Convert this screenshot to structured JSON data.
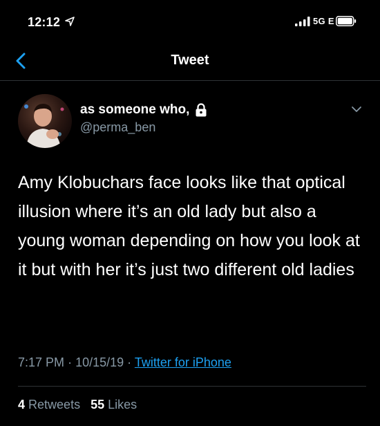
{
  "status_bar": {
    "time": "12:12",
    "network": "5G E",
    "location_icon": "location-arrow-icon",
    "signal_icon": "signal-bars-icon",
    "battery_icon": "battery-icon"
  },
  "nav": {
    "title": "Tweet",
    "back_icon": "chevron-left-icon"
  },
  "author": {
    "display_name": "as someone who,",
    "handle": "@perma_ben",
    "protected_icon": "lock-icon"
  },
  "tweet": {
    "text": "Amy Klobuchars face looks like that optical illusion where it’s an old lady but also a young woman depending on how you look at it but with her it’s just two different old ladies",
    "time": "7:17 PM",
    "date": "10/15/19",
    "separator": "·",
    "source": "Twitter for iPhone"
  },
  "stats": {
    "retweets_count": "4",
    "retweets_label": "Retweets",
    "likes_count": "55",
    "likes_label": "Likes"
  },
  "colors": {
    "background": "#000000",
    "text": "#ffffff",
    "secondary_text": "#8899a6",
    "link": "#1da1f2",
    "accent": "#1da1f2",
    "divider": "#2f3336"
  }
}
